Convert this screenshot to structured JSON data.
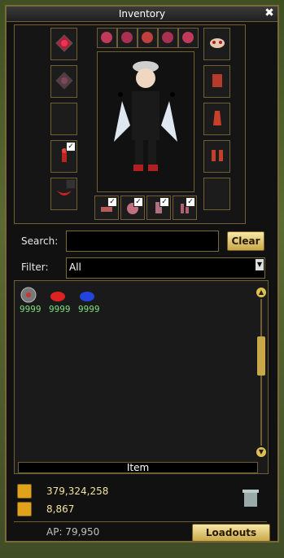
{
  "window": {
    "title": "Inventory",
    "close_label": "✖"
  },
  "search": {
    "label": "Search:",
    "value": "",
    "clear_label": "Clear"
  },
  "filter": {
    "label": "Filter:",
    "value": "All"
  },
  "items": [
    {
      "icon": "gear-orb-icon",
      "count": "9999"
    },
    {
      "icon": "red-slime-icon",
      "count": "9999"
    },
    {
      "icon": "blue-slime-icon",
      "count": "9999"
    }
  ],
  "items_tab": {
    "label": "Item"
  },
  "currency": [
    {
      "icon": "gold-bar-icon",
      "value": "379,324,258"
    },
    {
      "icon": "gold-coin-icon",
      "value": "8,867"
    }
  ],
  "ap": {
    "text": "AP: 79,950"
  },
  "loadouts": {
    "label": "Loadouts"
  },
  "colors": {
    "frame_gold": "#7a6a3a",
    "button_gold": "#c9a84a",
    "count_green": "#7fe07f",
    "currency_text": "#f2e3a0"
  }
}
